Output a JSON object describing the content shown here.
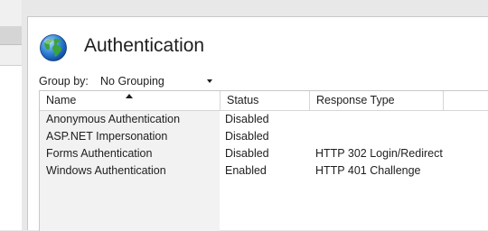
{
  "page": {
    "title": "Authentication"
  },
  "group_by": {
    "label": "Group by:",
    "value": "No Grouping"
  },
  "table": {
    "columns": [
      "Name",
      "Status",
      "Response Type",
      ""
    ],
    "sort_column": "Name",
    "sort_direction": "ascending",
    "rows": [
      {
        "name": "Anonymous Authentication",
        "status": "Disabled",
        "response_type": ""
      },
      {
        "name": "ASP.NET Impersonation",
        "status": "Disabled",
        "response_type": ""
      },
      {
        "name": "Forms Authentication",
        "status": "Disabled",
        "response_type": "HTTP 302 Login/Redirect"
      },
      {
        "name": "Windows Authentication",
        "status": "Enabled",
        "response_type": "HTTP 401 Challenge"
      }
    ]
  },
  "icons": {
    "title_icon": "globe-icon",
    "sort_icon": "sort-ascending-icon",
    "dropdown_icon": "chevron-down-icon"
  }
}
